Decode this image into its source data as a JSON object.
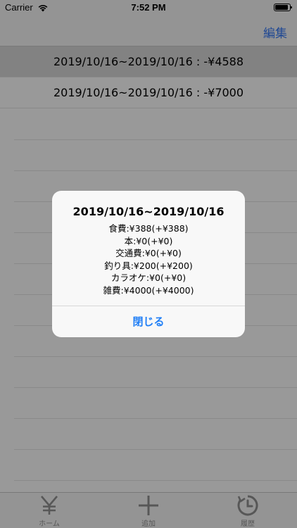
{
  "status_bar": {
    "carrier": "Carrier",
    "time": "7:52 PM"
  },
  "nav": {
    "edit_label": "編集"
  },
  "list": {
    "rows": [
      {
        "label": "2019/10/16~2019/10/16 : -¥4588"
      },
      {
        "label": "2019/10/16~2019/10/16 : -¥7000"
      }
    ]
  },
  "alert": {
    "title": "2019/10/16~2019/10/16",
    "lines": [
      "食費:¥388(+¥388)",
      "本:¥0(+¥0)",
      "交通費:¥0(+¥0)",
      "釣り具:¥200(+¥200)",
      "カラオケ:¥0(+¥0)",
      "雑費:¥4000(+¥4000)"
    ],
    "close_label": "閉じる"
  },
  "tab_bar": {
    "tabs": [
      {
        "label": "ホーム",
        "icon": "yen-icon"
      },
      {
        "label": "追加",
        "icon": "plus-icon"
      },
      {
        "label": "履歴",
        "icon": "history-icon"
      }
    ]
  },
  "colors": {
    "accent": "#3478f6",
    "alert_button": "#1f7ef6",
    "tab_inactive": "#929292",
    "overlay": "rgba(0,0,0,0.4)"
  }
}
